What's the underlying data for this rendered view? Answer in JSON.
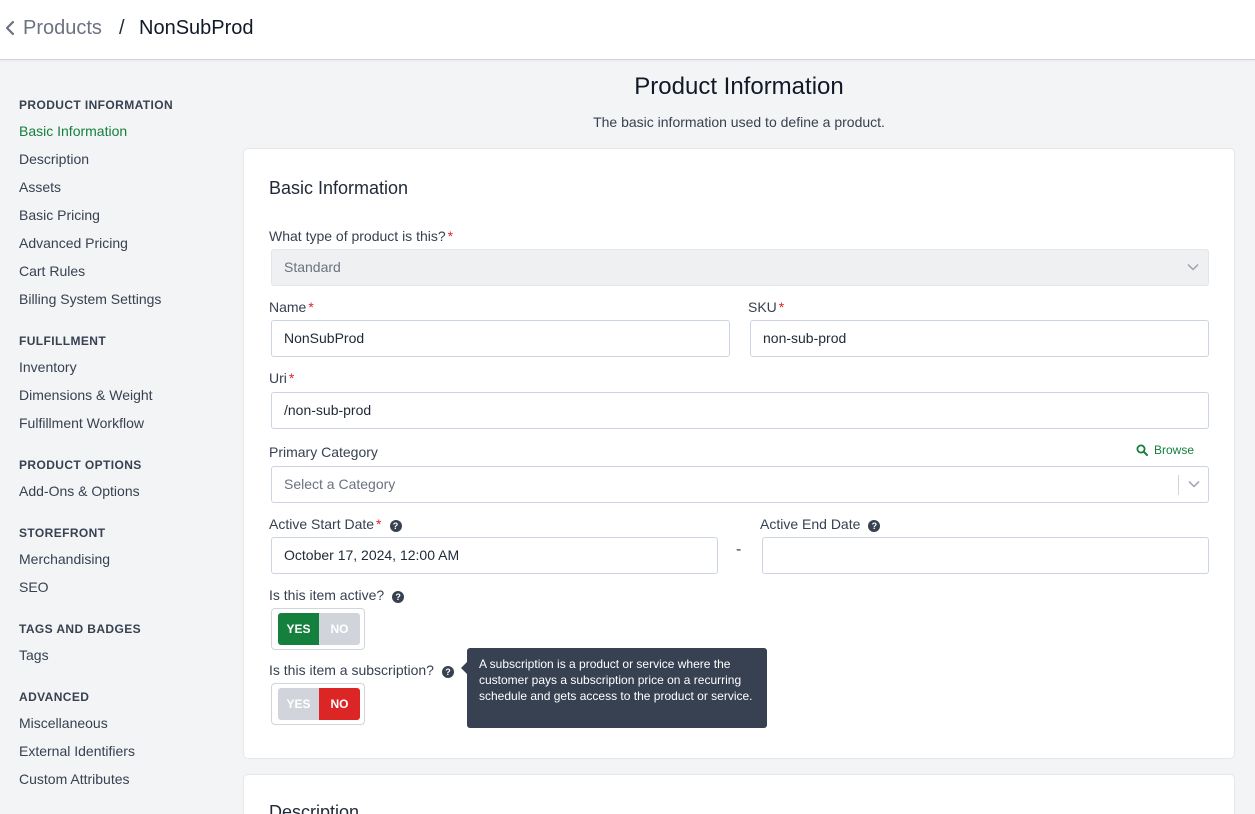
{
  "breadcrumb": {
    "parent": "Products",
    "separator": "/",
    "current": "NonSubProd"
  },
  "sidebar": {
    "groups": [
      {
        "title": "PRODUCT INFORMATION",
        "items": [
          "Basic Information",
          "Description",
          "Assets",
          "Basic Pricing",
          "Advanced Pricing",
          "Cart Rules",
          "Billing System Settings"
        ]
      },
      {
        "title": "FULFILLMENT",
        "items": [
          "Inventory",
          "Dimensions & Weight",
          "Fulfillment Workflow"
        ]
      },
      {
        "title": "PRODUCT OPTIONS",
        "items": [
          "Add-Ons & Options"
        ]
      },
      {
        "title": "STOREFRONT",
        "items": [
          "Merchandising",
          "SEO"
        ]
      },
      {
        "title": "TAGS AND BADGES",
        "items": [
          "Tags"
        ]
      },
      {
        "title": "ADVANCED",
        "items": [
          "Miscellaneous",
          "External Identifiers",
          "Custom Attributes"
        ]
      }
    ],
    "active_item": "Basic Information"
  },
  "page": {
    "title": "Product Information",
    "subtitle": "The basic information used to define a product."
  },
  "basic_info": {
    "title": "Basic Information",
    "product_type": {
      "label": "What type of product is this?",
      "value": "Standard"
    },
    "name": {
      "label": "Name",
      "value": "NonSubProd"
    },
    "sku": {
      "label": "SKU",
      "value": "non-sub-prod"
    },
    "uri": {
      "label": "Uri",
      "value": "/non-sub-prod"
    },
    "primary_category": {
      "label": "Primary Category",
      "placeholder": "Select a Category",
      "browse_label": "Browse"
    },
    "active_start": {
      "label": "Active Start Date",
      "value": "October 17, 2024, 12:00 AM"
    },
    "date_separator": "-",
    "active_end": {
      "label": "Active End Date",
      "value": ""
    },
    "is_active": {
      "label": "Is this item active?",
      "yes": "YES",
      "no": "NO",
      "selected": "YES"
    },
    "is_subscription": {
      "label": "Is this item a subscription?",
      "yes": "YES",
      "no": "NO",
      "selected": "NO"
    },
    "subscription_tooltip": "A subscription is a product or service where the customer pays a subscription price on a recurring schedule and gets access to the product or service."
  },
  "description_section": {
    "title": "Description"
  },
  "required_marker": "*",
  "help_glyph": "?",
  "colors": {
    "accent_green": "#15803d",
    "toggle_yes_active": "#15803d",
    "toggle_no_active": "#dc2626",
    "toggle_inactive": "#d1d5db",
    "required": "#dc2626",
    "tooltip_bg": "#374151"
  },
  "icons": {
    "back": "chevron-left-icon",
    "dropdown": "chevron-down-icon",
    "browse": "search-icon",
    "help": "question-circle-icon"
  }
}
